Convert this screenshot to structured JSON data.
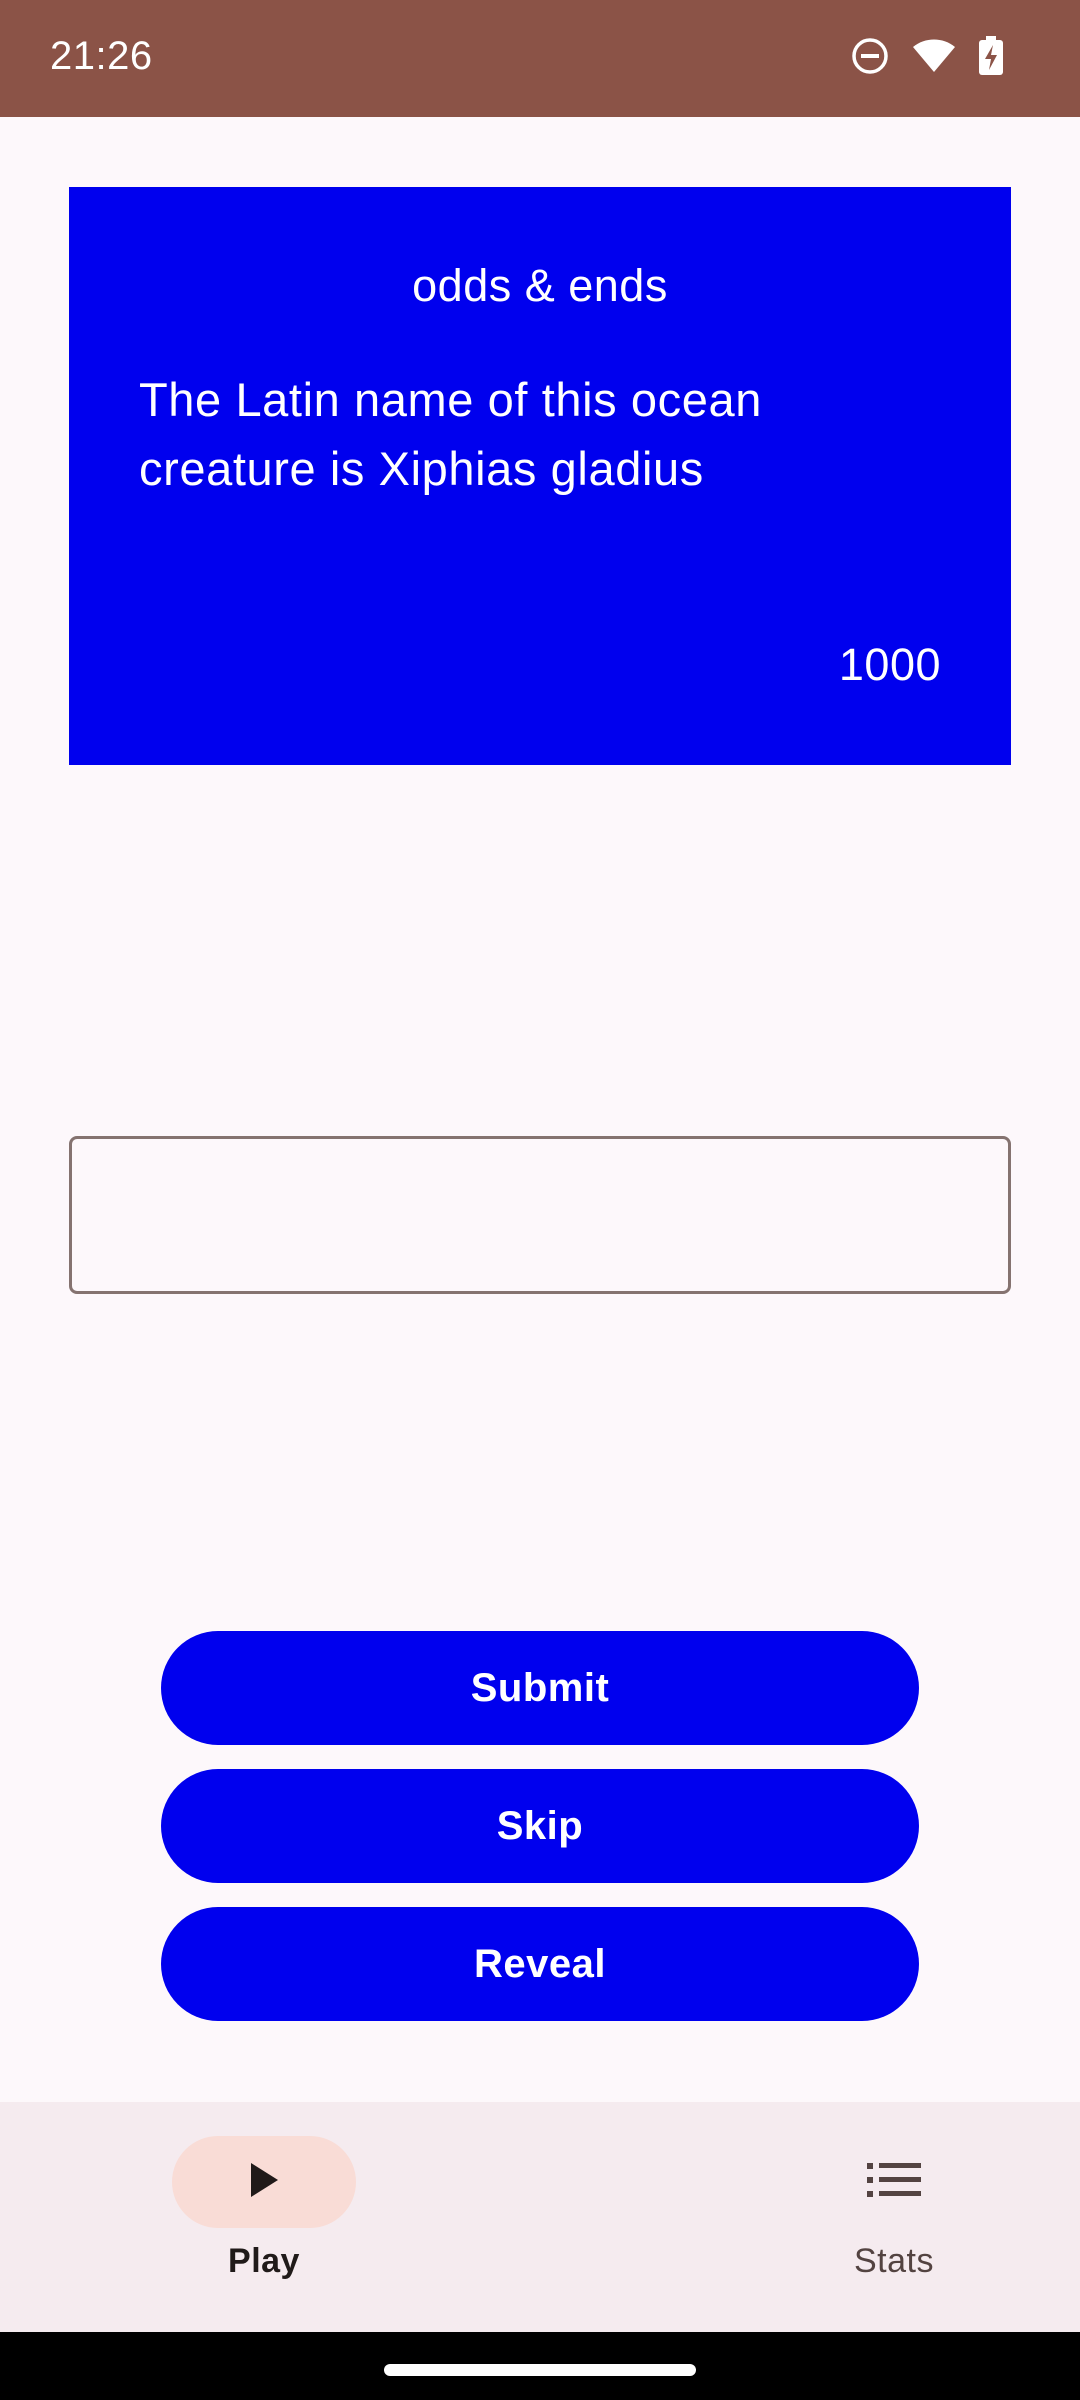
{
  "status_bar": {
    "time": "21:26",
    "icons": [
      "do-not-disturb-icon",
      "wifi-icon",
      "battery-charging-icon"
    ],
    "background": "#8b5347"
  },
  "clue_card": {
    "category": "odds & ends",
    "clue": "The Latin name of this ocean creature is Xiphias gladius",
    "value": "1000",
    "background": "#0000ee"
  },
  "answer_input": {
    "value": "",
    "placeholder": ""
  },
  "actions": {
    "submit_label": "Submit",
    "skip_label": "Skip",
    "reveal_label": "Reveal",
    "accent": "#0000ee"
  },
  "bottom_nav": {
    "items": [
      {
        "label": "Play",
        "icon": "play-icon",
        "selected": true
      },
      {
        "label": "Stats",
        "icon": "list-icon",
        "selected": false
      }
    ],
    "indicator_color": "#f9dcd6"
  }
}
